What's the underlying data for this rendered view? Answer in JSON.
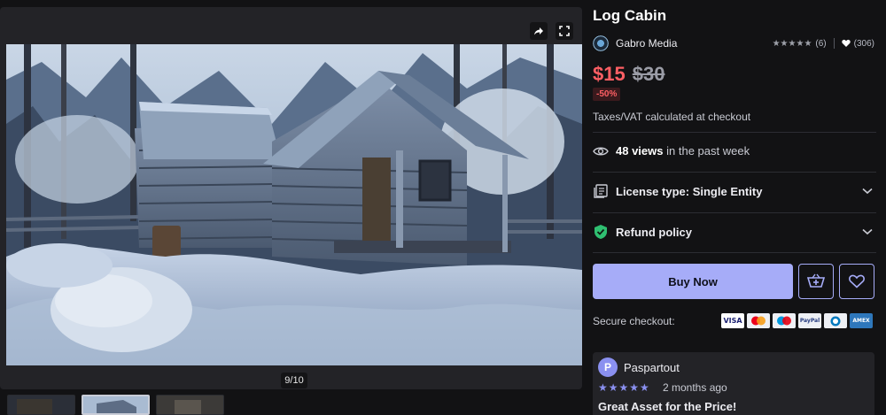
{
  "gallery": {
    "counter": "9/10",
    "share_icon": "share-icon",
    "fullscreen_icon": "fullscreen-icon"
  },
  "product": {
    "title": "Log Cabin",
    "seller": "Gabro Media",
    "rating_count": "(6)",
    "likes": "(306)",
    "price_now": "$15",
    "price_old": "$30",
    "discount": "-50%",
    "tax_note": "Taxes/VAT calculated at checkout",
    "views_count": "48 views",
    "views_suffix": "in the past week",
    "license_label": "License type: Single Entity",
    "refund_label": "Refund policy",
    "buy_label": "Buy Now",
    "secure_label": "Secure checkout:",
    "payment_cards": [
      "VISA",
      "MC",
      "Maestro",
      "PayPal",
      "Diners",
      "AMEX"
    ]
  },
  "review": {
    "avatar_letter": "P",
    "author": "Paspartout",
    "stars": "★★★★★",
    "time": "2 months ago",
    "title": "Great Asset for the Price!"
  },
  "colors": {
    "accent": "#a6acf8",
    "sale_red": "#ff5f64",
    "background": "#121214",
    "surface": "#232327",
    "refund_green": "#2fbf71"
  }
}
